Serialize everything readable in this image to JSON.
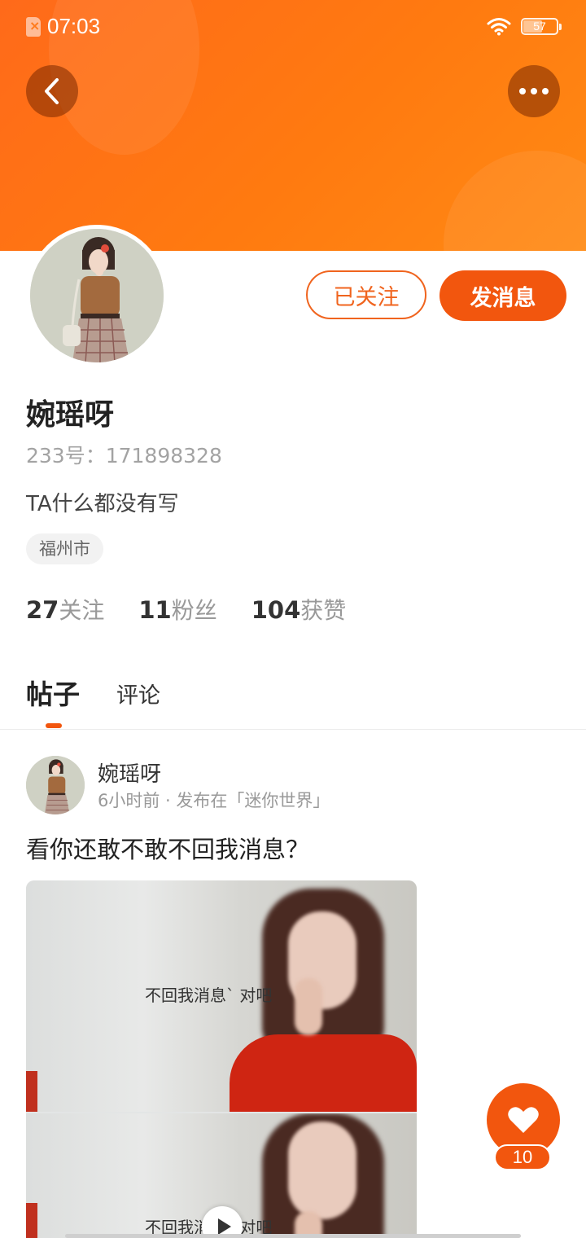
{
  "status_bar": {
    "time": "07:03",
    "battery": "57",
    "battery_level": 0.57
  },
  "header": {
    "back_icon": "chevron-left-icon",
    "more_icon": "more-dots-icon",
    "accent_color": "#f2560e"
  },
  "profile": {
    "name": "婉瑶呀",
    "id_text": "233号：171898328",
    "bio": "TA什么都没有写",
    "location": "福州市",
    "following_btn": "已关注",
    "message_btn": "发消息"
  },
  "stats": [
    {
      "num": "27",
      "label": "关注"
    },
    {
      "num": "11",
      "label": "粉丝"
    },
    {
      "num": "104",
      "label": "获赞"
    }
  ],
  "tabs": {
    "posts": "帖子",
    "comments": "评论"
  },
  "post": {
    "author": "婉瑶呀",
    "meta": "6小时前 · 发布在「迷你世界」",
    "text": "看你还敢不敢不回我消息？",
    "caption": "不回我消息` 对吧"
  },
  "like": {
    "count": "10",
    "icon": "heart-icon"
  }
}
